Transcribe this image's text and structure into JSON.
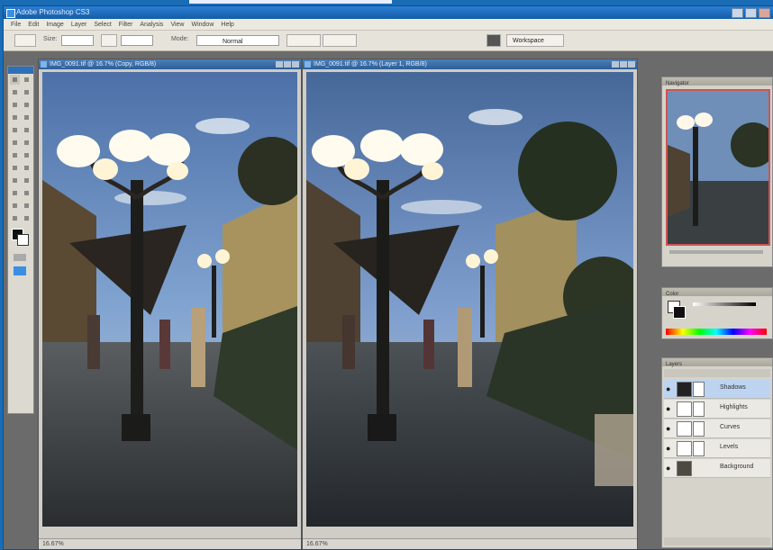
{
  "app": {
    "title": "Adobe Photoshop CS3",
    "menus": [
      "File",
      "Edit",
      "Image",
      "Layer",
      "Select",
      "Filter",
      "Analysis",
      "View",
      "Window",
      "Help"
    ]
  },
  "options": {
    "mode_label": "Mode:",
    "mode_value": "Normal",
    "size_label": "Size:",
    "workspace_label": "Workspace"
  },
  "documents": {
    "left": {
      "title": "IMG_0091.tif @ 16.7% (Copy, RGB/8)",
      "status": "16.67%"
    },
    "right": {
      "title": "IMG_0091.tif @ 16.7% (Layer 1, RGB/8)",
      "status": "16.67%"
    }
  },
  "panels": {
    "navigator_tab": "Navigator",
    "color_tab": "Color",
    "layers_tab": "Layers",
    "layers": [
      {
        "name": "Shadows",
        "active": true
      },
      {
        "name": "Highlights",
        "active": false
      },
      {
        "name": "Curves",
        "active": false
      },
      {
        "name": "Levels",
        "active": false
      },
      {
        "name": "Background",
        "active": false
      }
    ]
  }
}
